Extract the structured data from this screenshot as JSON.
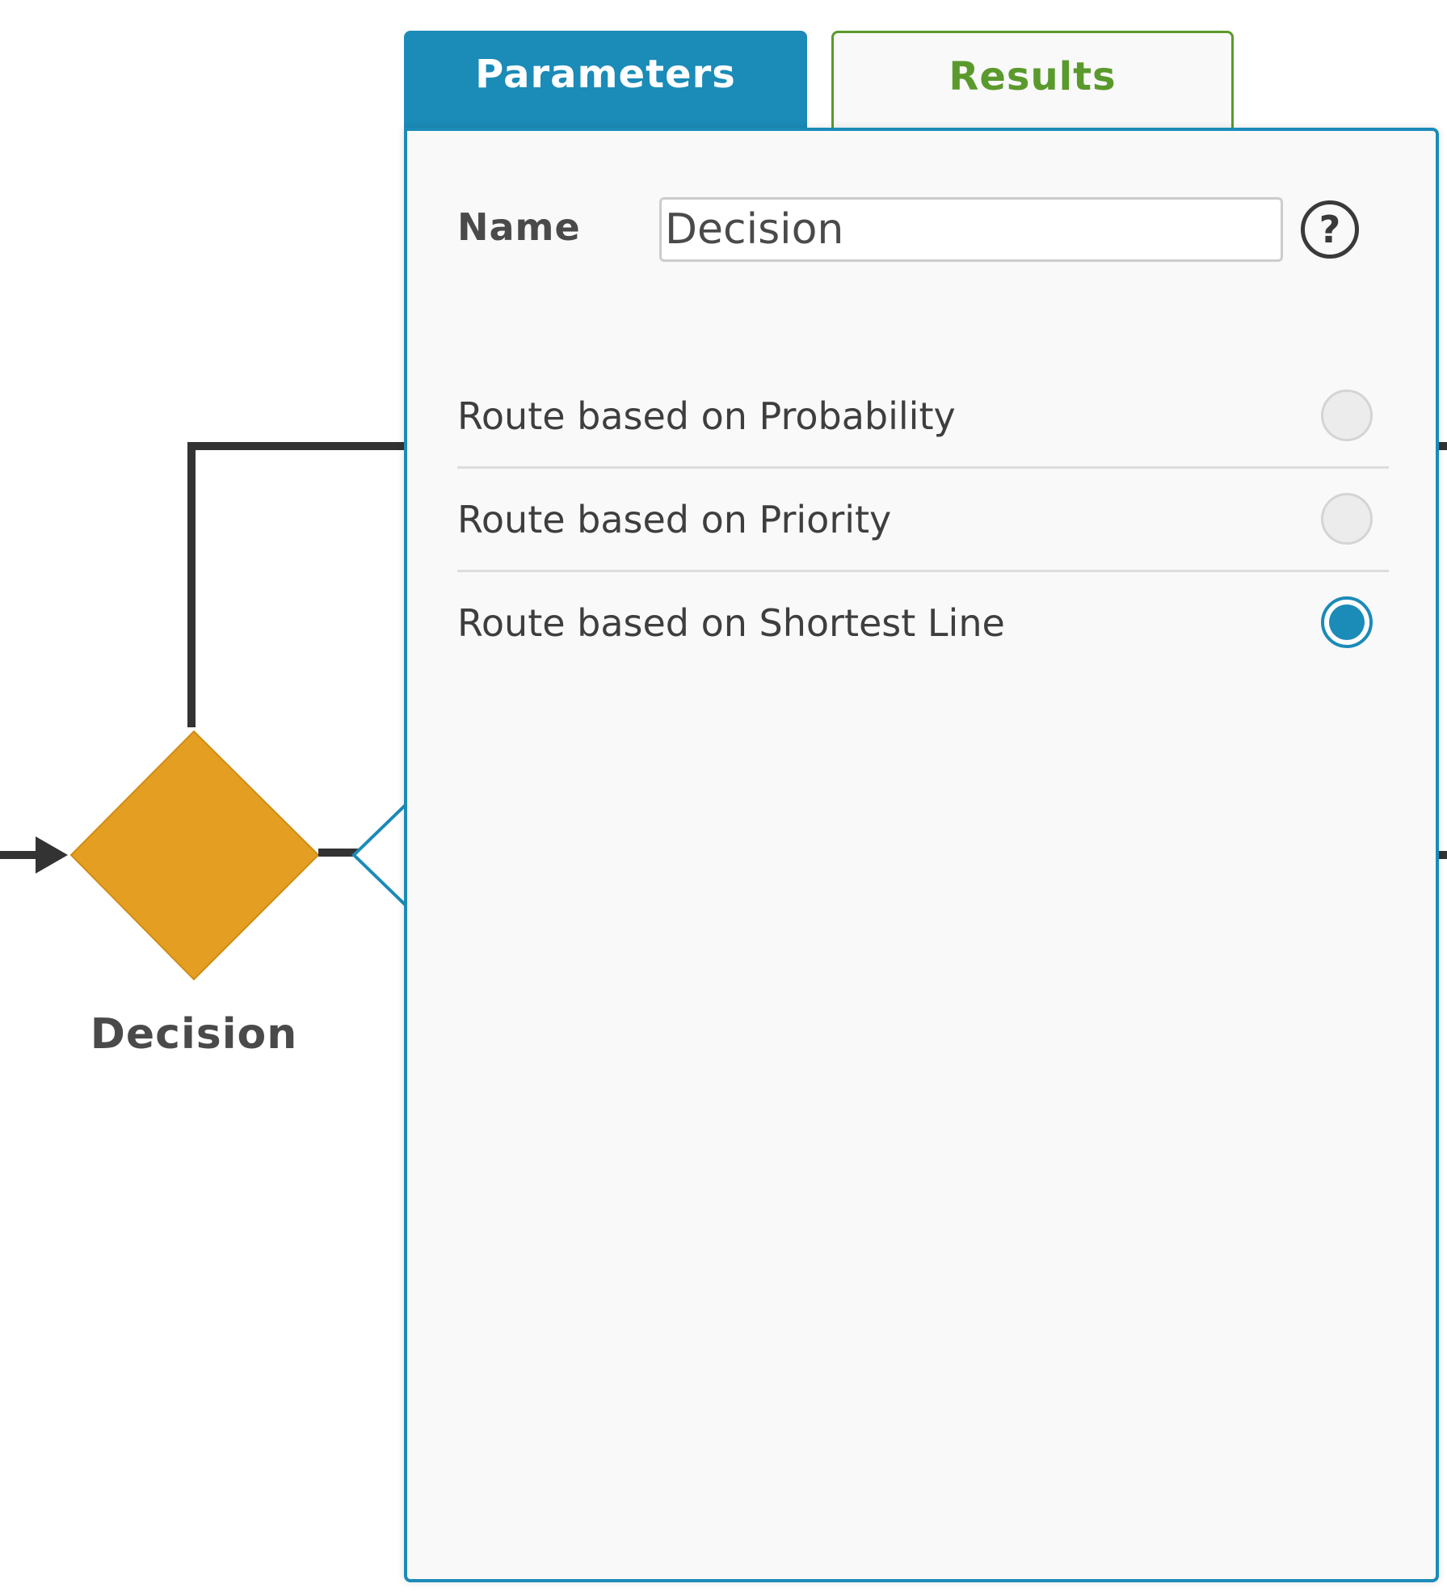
{
  "canvas": {
    "node_label": "Decision"
  },
  "tabs": [
    {
      "label": "Parameters",
      "active": true
    },
    {
      "label": "Results",
      "active": false
    }
  ],
  "parameters": {
    "name_label": "Name",
    "name_value": "Decision",
    "help_icon": "?",
    "options": [
      {
        "label": "Route based on Probability",
        "selected": false
      },
      {
        "label": "Route based on Priority",
        "selected": false
      },
      {
        "label": "Route based on Shortest Line",
        "selected": true
      }
    ]
  },
  "colors": {
    "accent": "#1b8bb8",
    "results_tab": "#5a9a2c",
    "decision_node": "#e49f22",
    "connector": "#333333"
  }
}
